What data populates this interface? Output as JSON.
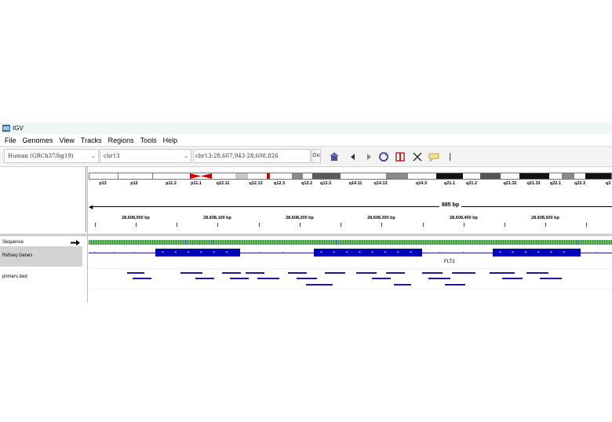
{
  "window": {
    "title": "IGV"
  },
  "menu": [
    "File",
    "Genomes",
    "View",
    "Tracks",
    "Regions",
    "Tools",
    "Help"
  ],
  "toolbar": {
    "genome": "Human (GRCh37/hg19)",
    "chromosome": "chr13",
    "locus": "chr13:28,607,943-28,608,826",
    "go_label": "Go",
    "icons": [
      "home-icon",
      "back-icon",
      "forward-icon",
      "refresh-icon",
      "roi-icon",
      "fit-icon",
      "popup-info-icon",
      "ruler-divider"
    ]
  },
  "ideogram": {
    "bands": [
      "p13",
      "p12",
      "p11.2",
      "p11.1",
      "q12.11",
      "q12.13",
      "q12.3",
      "q13.2",
      "q13.3",
      "q14.11",
      "q14.13",
      "q14.3",
      "q21.1",
      "q21.2",
      "q21.32",
      "q21.33",
      "q22.1",
      "q22.3",
      "q3"
    ]
  },
  "ruler": {
    "span": "885 bp",
    "ticks": [
      "28,608,000 bp",
      "28,608,100 bp",
      "28,608,200 bp",
      "28,608,300 bp",
      "28,608,400 bp",
      "28,608,500 bp"
    ]
  },
  "tracks": {
    "sequence": "Sequence",
    "refseq": "Refseq Genes",
    "primers": "primers.bed"
  },
  "gene": {
    "name": "FLT3",
    "strand_glyph": "<"
  },
  "colors": {
    "exon": "#0000b8",
    "feature": "#1c1c9a",
    "centromere": "#cc0000",
    "refseq_bg": "#d3d3d3"
  }
}
